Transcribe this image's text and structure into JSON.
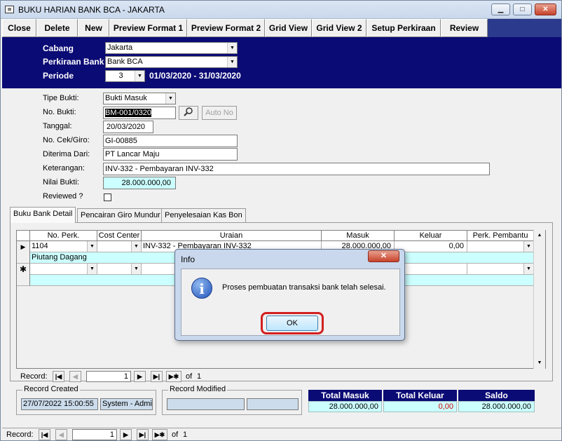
{
  "window": {
    "title": "BUKU HARIAN BANK BCA - JAKARTA",
    "title_icon": "form-icon",
    "minimize": "▁",
    "maximize": "□",
    "close": "✕"
  },
  "toolbar": {
    "buttons": [
      "Close",
      "Delete",
      "New",
      "Preview Format 1",
      "Preview Format 2",
      "Grid View",
      "Grid View 2",
      "Setup Perkiraan",
      "Review"
    ]
  },
  "header": {
    "cabang_label": "Cabang",
    "cabang_value": "Jakarta",
    "perkiraan_label": "Perkiraan Bank",
    "perkiraan_value": "Bank BCA",
    "periode_label": "Periode",
    "periode_value": "3",
    "periode_range": "01/03/2020 - 31/03/2020"
  },
  "form": {
    "tipe_bukti_label": "Tipe Bukti:",
    "tipe_bukti_value": "Bukti Masuk",
    "no_bukti_label": "No. Bukti:",
    "no_bukti_value": "BM-001/0320",
    "auto_no_label": "Auto No",
    "tanggal_label": "Tanggal:",
    "tanggal_value": "20/03/2020",
    "no_cek_label": "No. Cek/Giro:",
    "no_cek_value": "GI-00885",
    "diterima_label": "Diterima Dari:",
    "diterima_value": "PT Lancar Maju",
    "keterangan_label": "Keterangan:",
    "keterangan_value": "INV-332 - Pembayaran INV-332",
    "nilai_label": "Nilai Bukti:",
    "nilai_value": "28.000.000,00",
    "reviewed_label": "Reviewed ?"
  },
  "tabs": [
    "Buku Bank Detail",
    "Pencairan Giro Mundur",
    "Penyelesaian Kas Bon"
  ],
  "grid": {
    "columns": [
      "No. Perk.",
      "Cost Center",
      "Uraian",
      "Masuk",
      "Keluar",
      "Perk. Pembantu"
    ],
    "row1": {
      "no_perk": "1104",
      "cost_center": "",
      "uraian": "INV-332 - Pembayaran INV-332",
      "masuk": "28.000.000,00",
      "keluar": "0,00",
      "perk_pembantu": "",
      "perk_name": "Piutang Dagang"
    },
    "nav": {
      "label": "Record:",
      "current": "1",
      "of": "of",
      "total": "1"
    }
  },
  "record_created": {
    "title": "Record Created",
    "date": "27/07/2022 15:00:55",
    "user": "System - Admi"
  },
  "record_modified": {
    "title": "Record Modified",
    "date": "",
    "user": ""
  },
  "totals": {
    "masuk_label": "Total Masuk",
    "masuk_value": "28.000.000,00",
    "keluar_label": "Total Keluar",
    "keluar_value": "0,00",
    "saldo_label": "Saldo",
    "saldo_value": "28.000.000,00"
  },
  "statusbar": {
    "label": "Record:",
    "current": "1",
    "of": "of",
    "total": "1"
  },
  "dialog": {
    "title": "Info",
    "message": "Proses pembuatan transaksi bank telah selesai.",
    "ok": "OK",
    "icon": "info-icon",
    "close": "✕"
  },
  "colors": {
    "header_bg": "#0b0b75",
    "cyan_field": "#ccffff",
    "keluar_red": "#d00000",
    "highlight_red": "#d22020"
  }
}
